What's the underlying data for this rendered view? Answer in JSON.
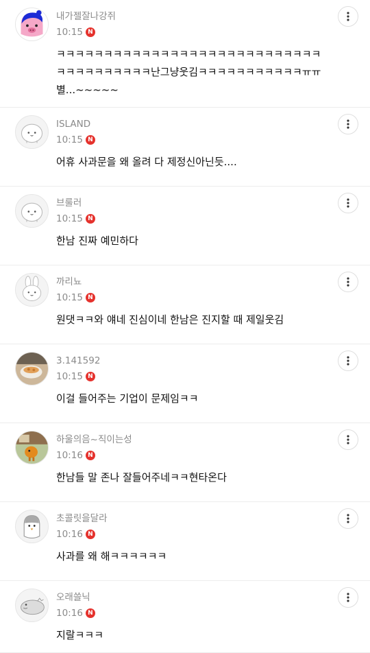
{
  "comments": [
    {
      "nickname": "내가젤잘나강쥐",
      "time": "10:15",
      "badge": "N",
      "avatar": "pink-pig-character-avatar",
      "text": "ㅋㅋㅋㅋㅋㅋㅋㅋㅋㅋㅋㅋㅋㅋㅋㅋㅋㅋㅋㅋㅋㅋㅋㅋㅋㅋㅋㅋㅋㅋㅋㅋㅋㅋㅋㅋㅋㅋ난그냥웃김ㅋㅋㅋㅋㅋㅋㅋㅋㅋㅋㅋㅠㅠ 별...~~~~~"
    },
    {
      "nickname": "ISLAND",
      "time": "10:15",
      "badge": "N",
      "avatar": "default-face-avatar",
      "text": "어휴 사과문을 왜 올려 다 제정신아닌듯...."
    },
    {
      "nickname": "브룰러",
      "time": "10:15",
      "badge": "N",
      "avatar": "default-face-avatar",
      "text": "한남 진짜 예민하다"
    },
    {
      "nickname": "까리뇨",
      "time": "10:15",
      "badge": "N",
      "avatar": "bunny-avatar",
      "text": "원댓ㅋㅋ와 얘네 진심이네 한남은 진지할 때 제일웃김"
    },
    {
      "nickname": "3.141592",
      "time": "10:15",
      "badge": "N",
      "avatar": "food-photo-avatar",
      "text": "이걸 들어주는 기업이 문제임ㅋㅋ"
    },
    {
      "nickname": "하울의음~직이는성",
      "time": "10:16",
      "badge": "N",
      "avatar": "animation-still-avatar",
      "text": "한남들 말 존나 잘들어주네ㅋㅋ현타온다"
    },
    {
      "nickname": "초콜릿을달라",
      "time": "10:16",
      "badge": "N",
      "avatar": "penguin-avatar",
      "text": "사과를 왜 해ㅋㅋㅋㅋㅋㅋ"
    },
    {
      "nickname": "오래쓸닉",
      "time": "10:16",
      "badge": "N",
      "avatar": "seal-avatar",
      "text": "지랄ㅋㅋㅋ"
    }
  ],
  "more_icon": "more-vertical-icon",
  "colors": {
    "badge": "#e5322d",
    "meta": "#8a8a8a",
    "divider": "#ececec"
  }
}
